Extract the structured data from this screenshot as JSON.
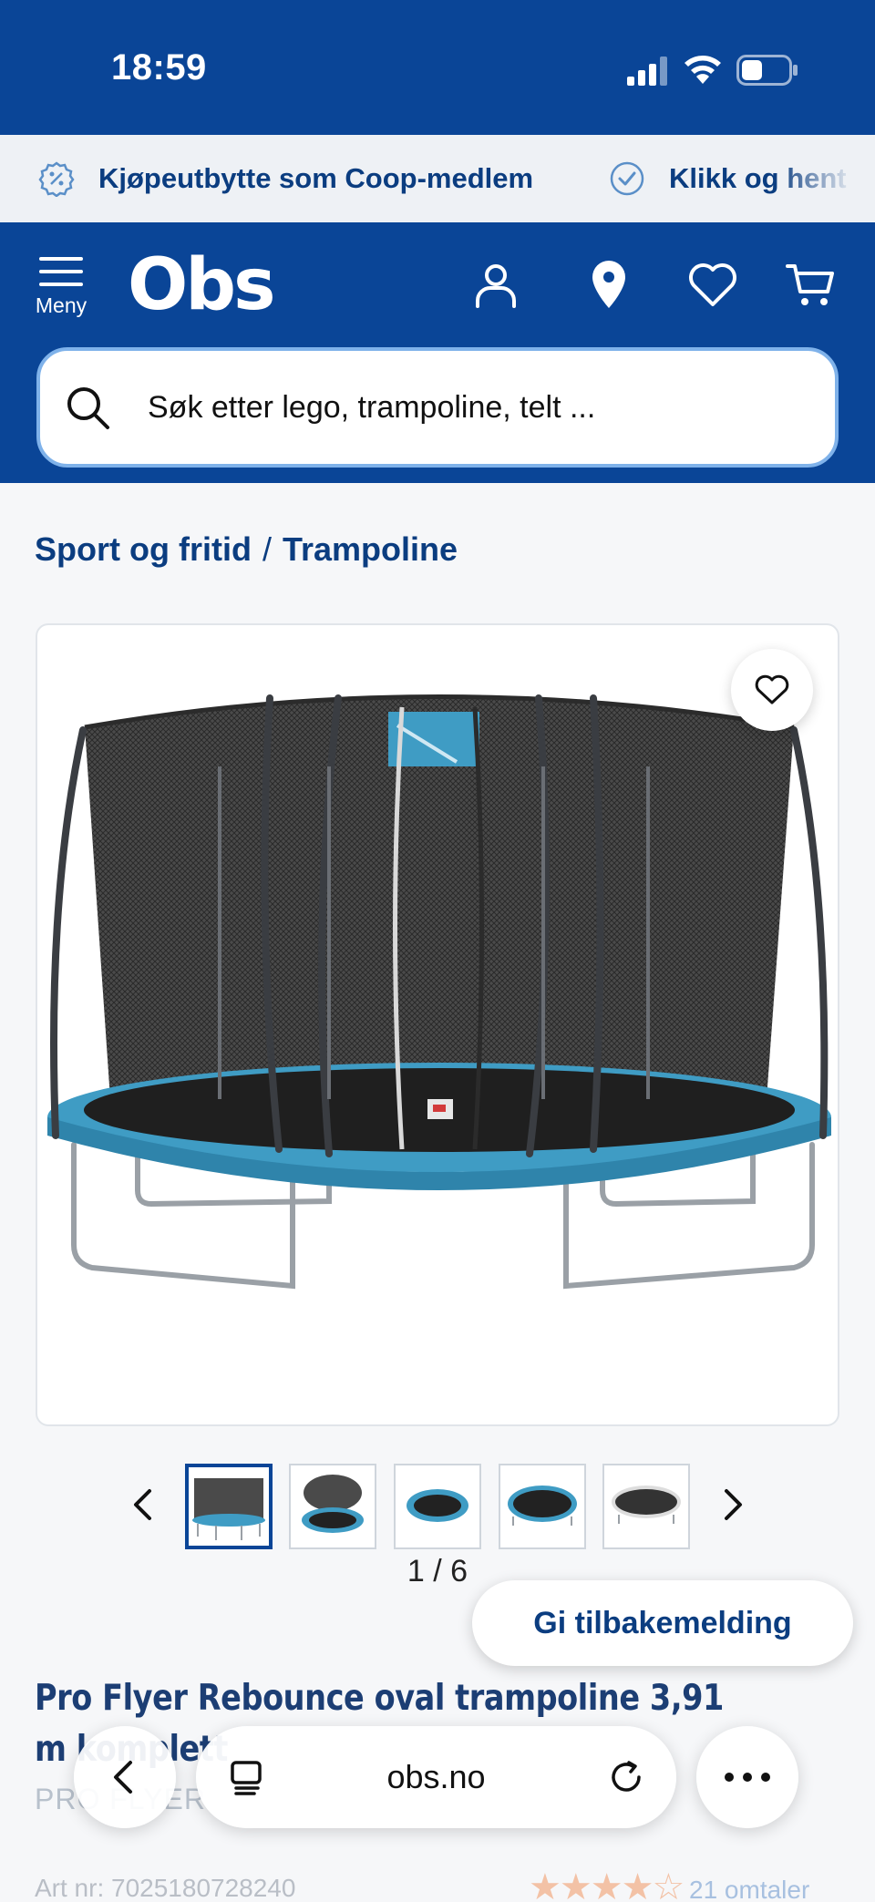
{
  "status_bar": {
    "time": "18:59"
  },
  "promo": {
    "items": [
      {
        "label": "Kjøpeutbytte som Coop-medlem",
        "icon": "percent-badge-icon"
      },
      {
        "label": "Klikk og hent",
        "icon": "check-circle-icon"
      }
    ]
  },
  "header": {
    "menu_label": "Meny",
    "logo": "Obs",
    "icons": [
      "user-icon",
      "location-pin-icon",
      "heart-icon",
      "cart-icon"
    ]
  },
  "search": {
    "placeholder": "Søk etter lego, trampoline, telt ..."
  },
  "breadcrumb": {
    "items": [
      "Sport og fritid",
      "Trampoline"
    ],
    "separator": "/"
  },
  "gallery": {
    "counter": "1 / 6",
    "thumbnail_count": 5,
    "active_index": 0
  },
  "feedback_button": "Gi tilbakemelding",
  "product": {
    "title": "Pro Flyer Rebounce oval trampoline 3,91 m komplett",
    "brand": "PRO FLYER",
    "art_nr": "Art nr: 7025180728240",
    "rating_stars": "★★★★☆",
    "reviews": "21 omtaler"
  },
  "browser": {
    "url": "obs.no"
  },
  "colors": {
    "brand_blue": "#0a4597",
    "text_blue": "#0b3d80",
    "trampoline_blue": "#3f9cc4"
  }
}
